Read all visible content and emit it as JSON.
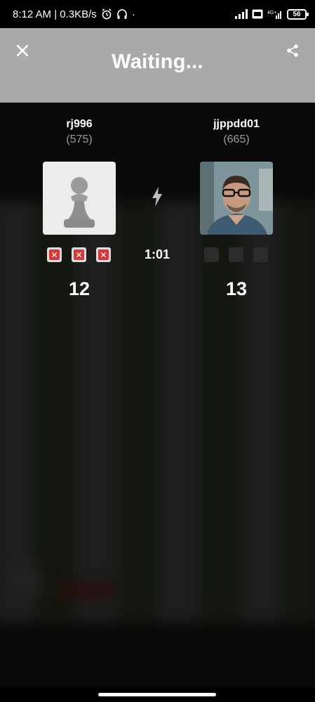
{
  "status_bar": {
    "time_speed": "8:12 AM | 0.3KB/s",
    "dot": "·",
    "network_label": "4G+",
    "battery": "56"
  },
  "header": {
    "title": "Waiting..."
  },
  "match": {
    "timer": "1:01",
    "left_player": {
      "name": "rj996",
      "rating": "(575)",
      "score": "12",
      "marks": [
        "miss",
        "miss",
        "miss"
      ]
    },
    "right_player": {
      "name": "jjppdd01",
      "rating": "(665)",
      "score": "13",
      "marks": [
        "empty",
        "empty",
        "empty"
      ]
    }
  },
  "colors": {
    "header_bg": "#a9a9a7",
    "miss_red": "#d43a3a",
    "background": "#0e0e0e"
  }
}
